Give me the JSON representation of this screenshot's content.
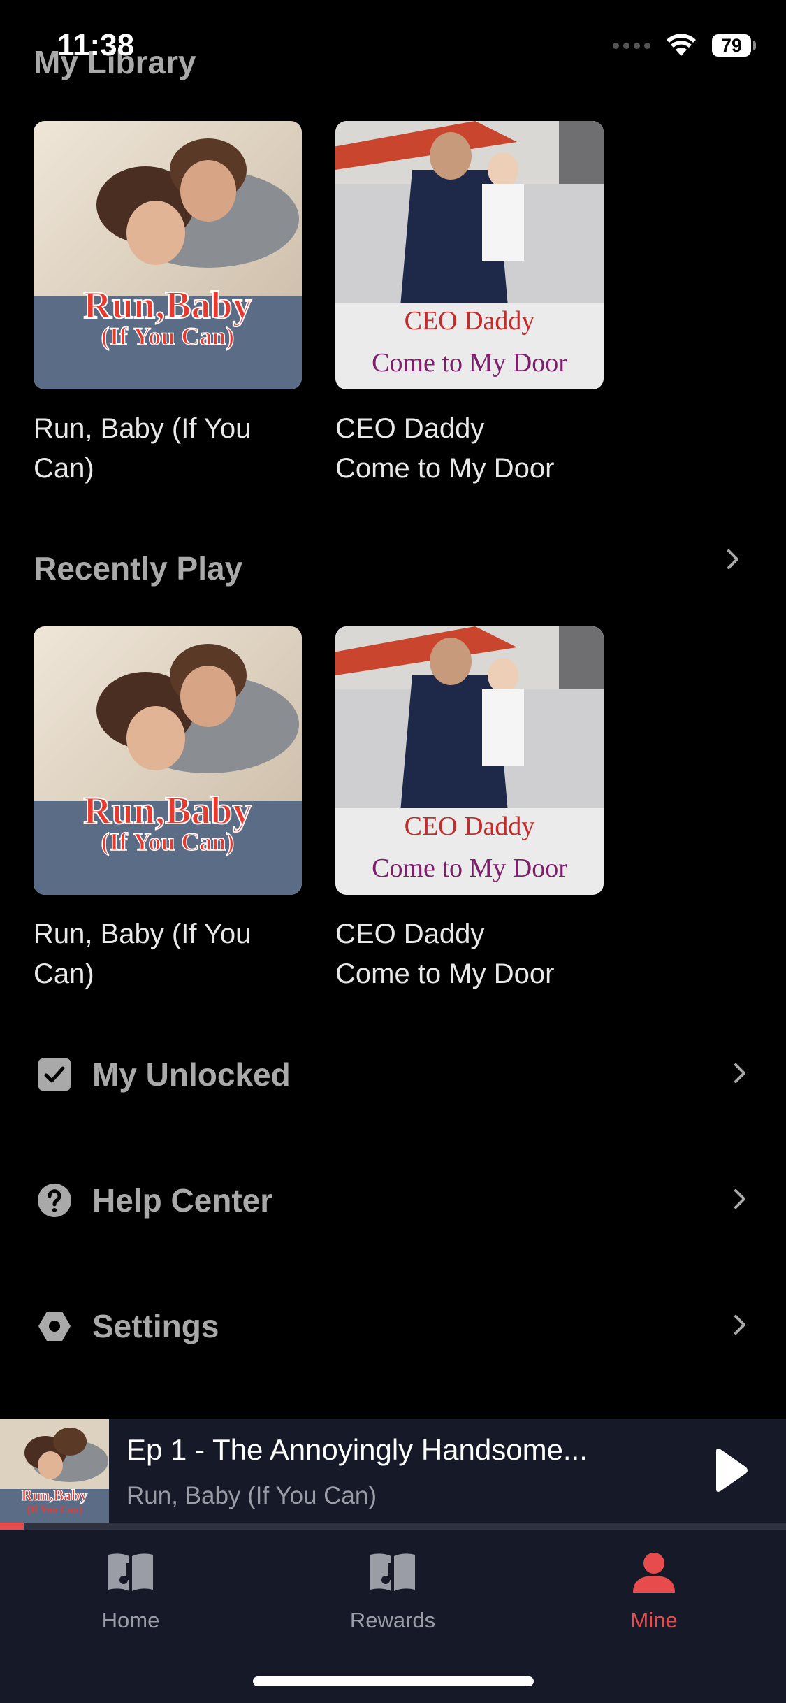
{
  "status_bar": {
    "time": "11:38",
    "battery": "79"
  },
  "library": {
    "title": "My Library",
    "items": [
      {
        "title": "Run, Baby (If You Can)",
        "cover_line1": "Run,Baby",
        "cover_line2": "(If You Can)"
      },
      {
        "title": "CEO Daddy Come to My Door",
        "cover_line1": "CEO Daddy",
        "cover_line2": "Come to My Door"
      }
    ]
  },
  "recent": {
    "title": "Recently Play",
    "items": [
      {
        "title": "Run, Baby (If You Can)",
        "cover_line1": "Run,Baby",
        "cover_line2": "(If You Can)"
      },
      {
        "title": "CEO Daddy Come to My Door",
        "cover_line1": "CEO Daddy",
        "cover_line2": "Come to My Door"
      }
    ]
  },
  "menu": [
    {
      "label": "My Unlocked",
      "icon": "checkbox-icon"
    },
    {
      "label": "Help Center",
      "icon": "question-circle-icon"
    },
    {
      "label": "Settings",
      "icon": "hexagon-gear-icon"
    }
  ],
  "mini_player": {
    "episode": "Ep 1 - The Annoyingly Handsome...",
    "show": "Run, Baby (If You Can)",
    "cover_line1": "Run,Baby",
    "cover_line2": "(If You Can)",
    "progress": 0.03
  },
  "tabs": [
    {
      "label": "Home",
      "icon": "book-icon"
    },
    {
      "label": "Rewards",
      "icon": "book-icon"
    },
    {
      "label": "Mine",
      "icon": "person-icon",
      "active": true
    }
  ],
  "colors": {
    "accent": "#e84b4b",
    "muted": "#a9a9a9",
    "bar_bg": "#161a28"
  }
}
